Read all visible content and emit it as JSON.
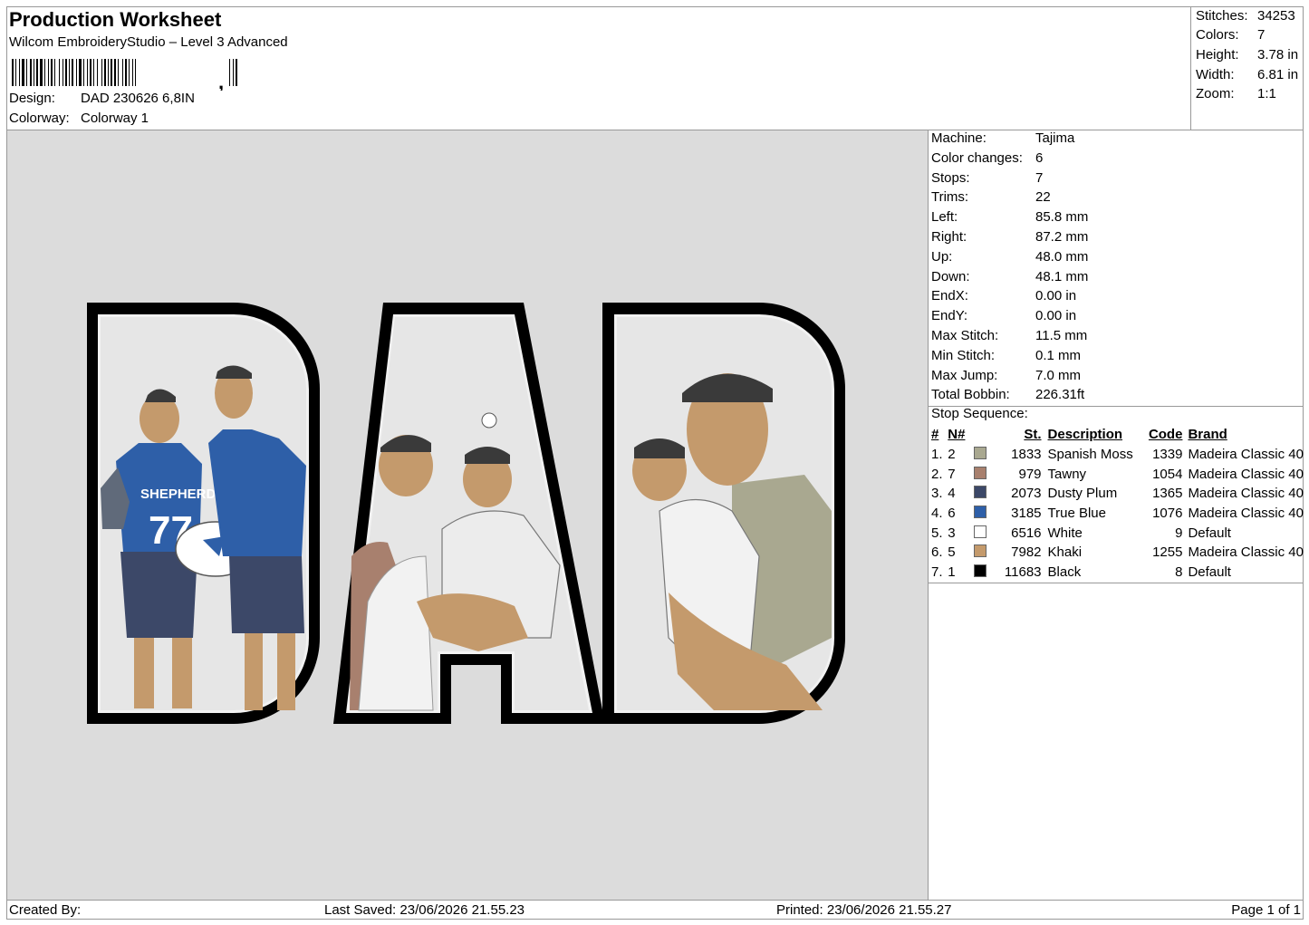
{
  "header": {
    "title": "Production Worksheet",
    "software": "Wilcom EmbroideryStudio – Level 3 Advanced",
    "barcode_suffix": ",",
    "design_label": "Design:",
    "design_value": "DAD 230626 6,8IN",
    "colorway_label": "Colorway:",
    "colorway_value": "Colorway 1"
  },
  "stats": [
    {
      "label": "Stitches:",
      "value": "34253"
    },
    {
      "label": "Colors:",
      "value": "7"
    },
    {
      "label": "Height:",
      "value": "3.78 in"
    },
    {
      "label": "Width:",
      "value": "6.81 in"
    },
    {
      "label": "Zoom:",
      "value": "1:1"
    }
  ],
  "machine_info": [
    {
      "label": "Machine:",
      "value": "Tajima"
    },
    {
      "label": "Color changes:",
      "value": "6"
    },
    {
      "label": "Stops:",
      "value": "7"
    },
    {
      "label": "Trims:",
      "value": "22"
    },
    {
      "label": "Left:",
      "value": "85.8 mm"
    },
    {
      "label": "Right:",
      "value": "87.2 mm"
    },
    {
      "label": "Up:",
      "value": "48.0 mm"
    },
    {
      "label": "Down:",
      "value": "48.1 mm"
    },
    {
      "label": "EndX:",
      "value": "0.00 in"
    },
    {
      "label": "EndY:",
      "value": "0.00 in"
    },
    {
      "label": "Max Stitch:",
      "value": "11.5 mm"
    },
    {
      "label": "Min Stitch:",
      "value": "0.1 mm"
    },
    {
      "label": "Max Jump:",
      "value": "7.0 mm"
    },
    {
      "label": "Total Bobbin:",
      "value": "226.31ft"
    }
  ],
  "stop_sequence": {
    "caption": "Stop Sequence:",
    "headers": {
      "idx": "#",
      "n": "N#",
      "st": "St.",
      "desc": "Description",
      "code": "Code",
      "brand": "Brand"
    },
    "rows": [
      {
        "idx": "1.",
        "n": "2",
        "color": "#a9a890",
        "st": "1833",
        "desc": "Spanish Moss",
        "code": "1339",
        "brand": "Madeira Classic 40"
      },
      {
        "idx": "2.",
        "n": "7",
        "color": "#a8806e",
        "st": "979",
        "desc": "Tawny",
        "code": "1054",
        "brand": "Madeira Classic 40"
      },
      {
        "idx": "3.",
        "n": "4",
        "color": "#3c4868",
        "st": "2073",
        "desc": "Dusty Plum",
        "code": "1365",
        "brand": "Madeira Classic 40"
      },
      {
        "idx": "4.",
        "n": "6",
        "color": "#2e5fa8",
        "st": "3185",
        "desc": "True Blue",
        "code": "1076",
        "brand": "Madeira Classic 40"
      },
      {
        "idx": "5.",
        "n": "3",
        "color": "#ffffff",
        "st": "6516",
        "desc": "White",
        "code": "9",
        "brand": "Default"
      },
      {
        "idx": "6.",
        "n": "5",
        "color": "#c49a6c",
        "st": "7982",
        "desc": "Khaki",
        "code": "1255",
        "brand": "Madeira Classic 40"
      },
      {
        "idx": "7.",
        "n": "1",
        "color": "#000000",
        "st": "11683",
        "desc": "Black",
        "code": "8",
        "brand": "Default"
      }
    ]
  },
  "preview": {
    "jersey_text": "SHEPHERD",
    "jersey_number": "77"
  },
  "footer": {
    "created_by": "Created By:",
    "last_saved": "Last Saved: 23/06/2026 21.55.23",
    "printed": "Printed: 23/06/2026 21.55.27",
    "page": "Page 1 of 1"
  }
}
